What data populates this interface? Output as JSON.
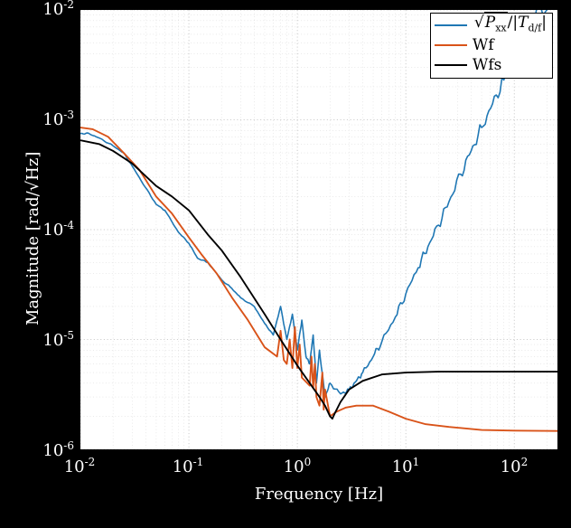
{
  "chart_data": {
    "type": "line",
    "xlabel": "Frequency [Hz]",
    "ylabel": "Magnitude [rad/√Hz]",
    "xscale": "log",
    "yscale": "log",
    "xlim": [
      0.01,
      250
    ],
    "ylim": [
      1e-06,
      0.01
    ],
    "xticks": [
      0.01,
      0.1,
      1,
      10,
      100
    ],
    "yticks": [
      1e-06,
      1e-05,
      0.0001,
      0.001,
      0.01
    ],
    "xtick_labels": [
      "10⁻²",
      "10⁻¹",
      "10⁰",
      "10¹",
      "10²"
    ],
    "ytick_labels": [
      "10⁻⁶",
      "10⁻⁵",
      "10⁻⁴",
      "10⁻³",
      "10⁻²"
    ],
    "legend_position": "upper right",
    "series": [
      {
        "name": "√Pxx / |T_d/f|",
        "color": "#1f77b4",
        "x": [
          0.01,
          0.012,
          0.015,
          0.02,
          0.025,
          0.03,
          0.04,
          0.05,
          0.06,
          0.08,
          0.1,
          0.12,
          0.15,
          0.2,
          0.25,
          0.3,
          0.4,
          0.5,
          0.6,
          0.7,
          0.8,
          0.9,
          1.0,
          1.1,
          1.2,
          1.3,
          1.4,
          1.5,
          1.6,
          1.8,
          2.0,
          2.5,
          3.0,
          3.5,
          4.0,
          5.0,
          6.0,
          8.0,
          10,
          13,
          16,
          20,
          25,
          32,
          40,
          50,
          63,
          80,
          100,
          130,
          160,
          200,
          240,
          250
        ],
        "y": [
          0.00075,
          0.00075,
          0.00068,
          0.00058,
          0.0005,
          0.00038,
          0.00024,
          0.00017,
          0.00015,
          9.5e-05,
          7.5e-05,
          5.5e-05,
          5e-05,
          3.5e-05,
          2.9e-05,
          2.4e-05,
          2e-05,
          1.4e-05,
          1.1e-05,
          2e-05,
          1e-05,
          1.7e-05,
          8e-06,
          1.5e-05,
          7e-06,
          6e-06,
          1.1e-05,
          4e-06,
          8e-06,
          3e-06,
          4e-06,
          3.2e-06,
          3.5e-06,
          4.2e-06,
          5e-06,
          7e-06,
          9.5e-06,
          1.6e-05,
          2.6e-05,
          4.5e-05,
          7e-05,
          0.00011,
          0.00018,
          0.00032,
          0.00052,
          0.00085,
          0.0014,
          0.0023,
          0.0037,
          0.0066,
          0.01,
          0.01,
          0.026,
          0.05
        ]
      },
      {
        "name": "Wf",
        "color": "#d95319",
        "x": [
          0.01,
          0.013,
          0.018,
          0.025,
          0.035,
          0.05,
          0.07,
          0.1,
          0.13,
          0.18,
          0.25,
          0.35,
          0.5,
          0.65,
          0.7,
          0.75,
          0.8,
          0.85,
          0.9,
          0.95,
          1.0,
          1.05,
          1.1,
          1.3,
          1.35,
          1.4,
          1.45,
          1.5,
          1.6,
          1.7,
          1.75,
          1.8,
          2.0,
          2.3,
          2.8,
          3.5,
          5,
          7,
          10,
          15,
          25,
          50,
          100,
          250
        ],
        "y": [
          0.00085,
          0.00082,
          0.0007,
          0.0005,
          0.00035,
          0.0002,
          0.00014,
          8.5e-05,
          6e-05,
          4e-05,
          2.4e-05,
          1.5e-05,
          8.5e-06,
          7e-06,
          1.2e-05,
          6.5e-06,
          6e-06,
          1e-05,
          5.5e-06,
          1.3e-05,
          5.5e-06,
          9e-06,
          4.5e-06,
          3.8e-06,
          7e-06,
          3.6e-06,
          6e-06,
          3e-06,
          2.5e-06,
          5e-06,
          2.3e-06,
          3.5e-06,
          2e-06,
          2.2e-06,
          2.4e-06,
          2.5e-06,
          2.5e-06,
          2.2e-06,
          1.9e-06,
          1.7e-06,
          1.6e-06,
          1.5e-06,
          1.48e-06,
          1.47e-06
        ]
      },
      {
        "name": "Wfs",
        "color": "#000000",
        "x": [
          0.01,
          0.015,
          0.02,
          0.03,
          0.05,
          0.07,
          0.1,
          0.15,
          0.2,
          0.3,
          0.5,
          0.7,
          1.0,
          1.3,
          1.6,
          1.8,
          2.0,
          2.1,
          2.2,
          2.5,
          3.0,
          4.0,
          6.0,
          10,
          20,
          50,
          100,
          250
        ],
        "y": [
          0.00065,
          0.0006,
          0.00052,
          0.0004,
          0.00025,
          0.0002,
          0.00015,
          9e-05,
          6.5e-05,
          3.7e-05,
          1.7e-05,
          1e-05,
          5.8e-06,
          4e-06,
          3e-06,
          2.5e-06,
          2e-06,
          1.9e-06,
          2.1e-06,
          2.7e-06,
          3.5e-06,
          4.2e-06,
          4.8e-06,
          5e-06,
          5.1e-06,
          5.1e-06,
          5.1e-06,
          5.1e-06
        ]
      }
    ]
  },
  "legend": {
    "items": [
      {
        "label_html": "√P<sub>xx</sub>/|T<sub>d/f</sub>|",
        "color": "#1f77b4"
      },
      {
        "label": "Wf",
        "color": "#d95319"
      },
      {
        "label": "Wfs",
        "color": "#000000"
      }
    ]
  },
  "axis_labels": {
    "x": "Frequency [Hz]",
    "y": "Magnitude [rad/√Hz]"
  },
  "ytick_html": [
    "10<span class=\"sup\">-6</span>",
    "10<span class=\"sup\">-5</span>",
    "10<span class=\"sup\">-4</span>",
    "10<span class=\"sup\">-3</span>",
    "10<span class=\"sup\">-2</span>"
  ],
  "xtick_html": [
    "10<span class=\"sup\">-2</span>",
    "10<span class=\"sup\">-1</span>",
    "10<span class=\"sup\">0</span>",
    "10<span class=\"sup\">1</span>",
    "10<span class=\"sup\">2</span>"
  ]
}
